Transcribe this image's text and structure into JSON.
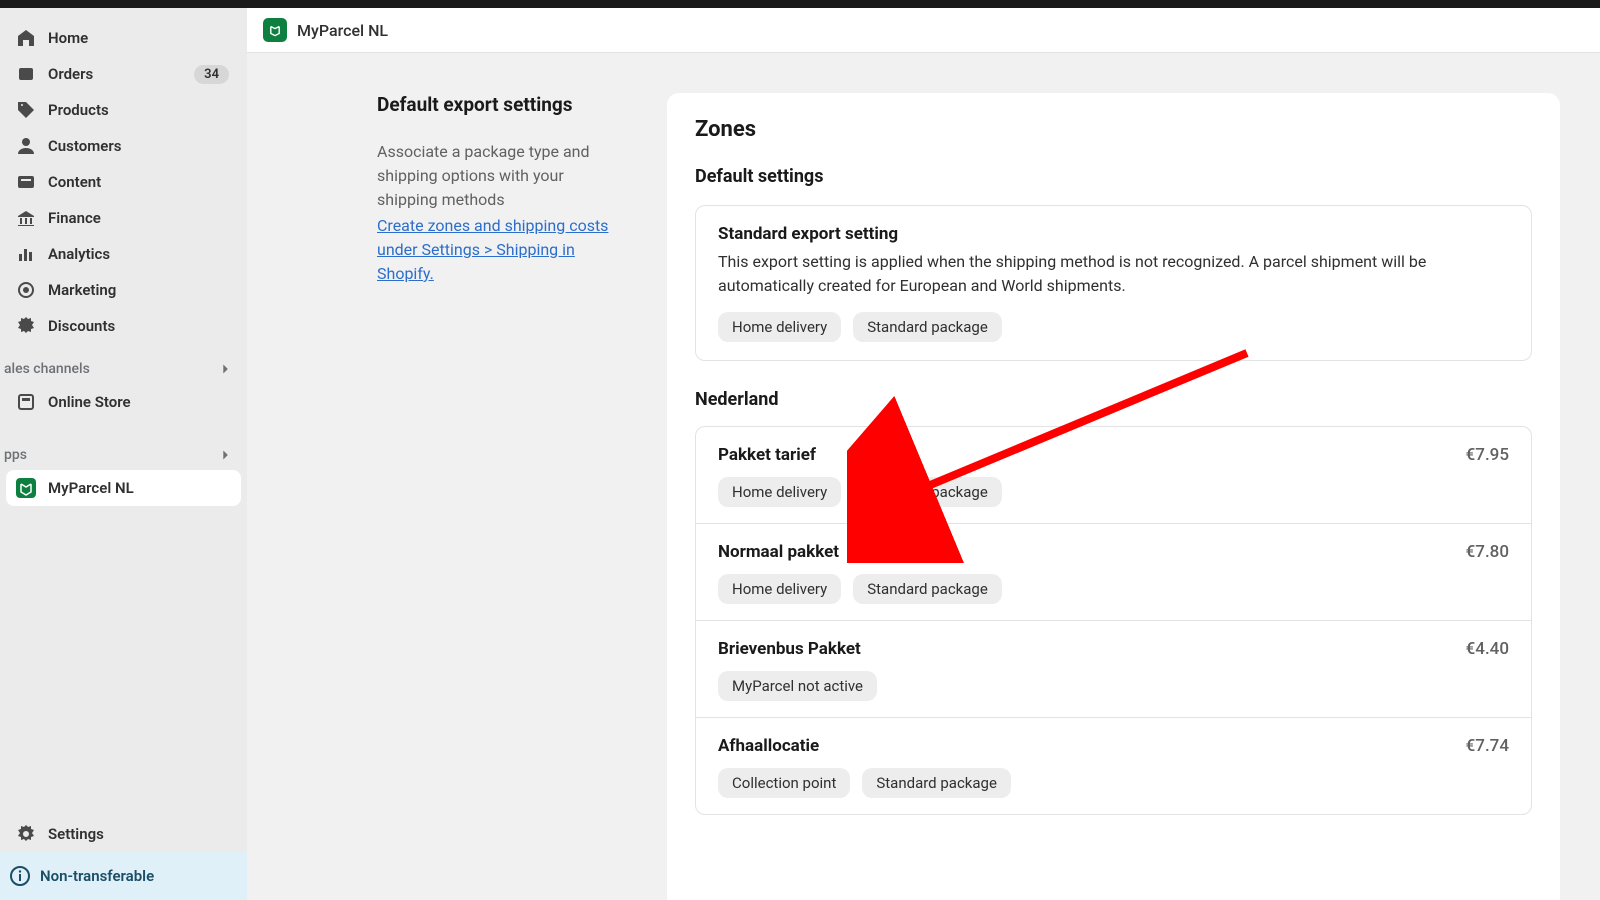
{
  "sidebar": {
    "items": [
      {
        "label": "Home"
      },
      {
        "label": "Orders",
        "badge": "34"
      },
      {
        "label": "Products"
      },
      {
        "label": "Customers"
      },
      {
        "label": "Content"
      },
      {
        "label": "Finance"
      },
      {
        "label": "Analytics"
      },
      {
        "label": "Marketing"
      },
      {
        "label": "Discounts"
      }
    ],
    "sales_channels_header": "ales channels",
    "online_store": "Online Store",
    "apps_header": "pps",
    "app_item": "MyParcel NL",
    "settings": "Settings",
    "non_transferable": "Non-transferable"
  },
  "header": {
    "app_title": "MyParcel NL"
  },
  "left": {
    "title": "Default export settings",
    "desc": "Associate a package type and shipping options with your shipping methods",
    "link": "Create zones and shipping costs under Settings > Shipping in Shopify."
  },
  "right": {
    "zones_title": "Zones",
    "default_settings": "Default settings",
    "standard": {
      "title": "Standard export setting",
      "desc": "This export setting is applied when the shipping method is not recognized. A parcel shipment will be automatically created for European and World shipments.",
      "pills": [
        "Home delivery",
        "Standard package"
      ]
    },
    "zone_name": "Nederland",
    "rates": [
      {
        "name": "Pakket tarief",
        "price": "€7.95",
        "pills": [
          "Home delivery",
          "Standard package"
        ]
      },
      {
        "name": "Normaal pakket",
        "price": "€7.80",
        "pills": [
          "Home delivery",
          "Standard package"
        ]
      },
      {
        "name": "Brievenbus Pakket",
        "price": "€4.40",
        "pills": [
          "MyParcel not active"
        ]
      },
      {
        "name": "Afhaallocatie",
        "price": "€7.74",
        "pills": [
          "Collection point",
          "Standard package"
        ]
      }
    ]
  }
}
